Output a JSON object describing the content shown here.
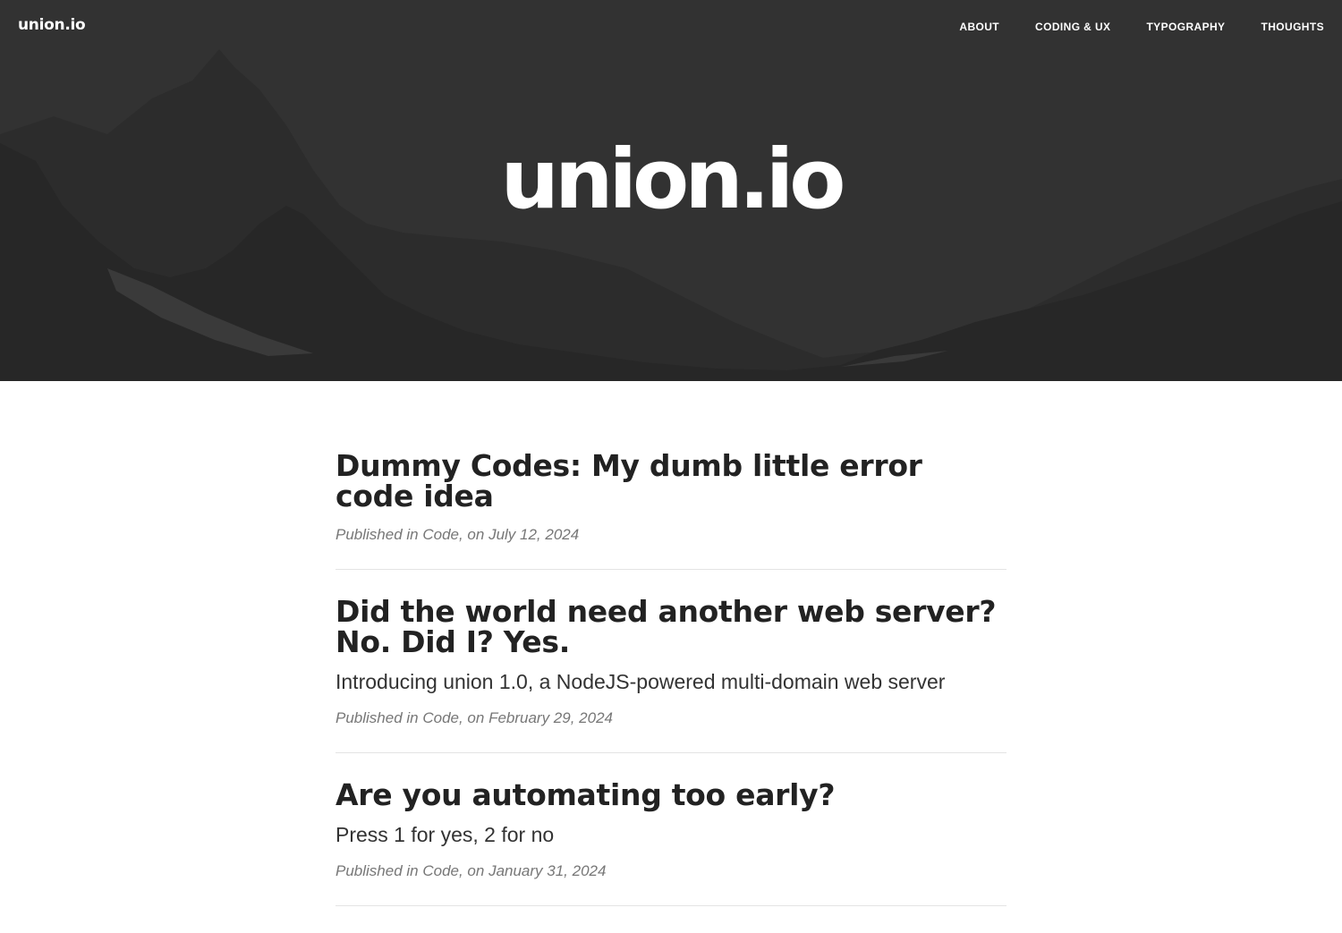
{
  "navbar": {
    "brand": "union.io",
    "links": [
      "ABOUT",
      "CODING & UX",
      "TYPOGRAPHY",
      "THOUGHTS"
    ]
  },
  "hero": {
    "title": "union.io"
  },
  "posts": [
    {
      "title": "Dummy Codes: My dumb little error code idea",
      "subtitle": "",
      "meta": "Published in Code, on July 12, 2024"
    },
    {
      "title": "Did the world need another web server? No. Did I? Yes.",
      "subtitle": "Introducing union 1.0, a NodeJS-powered multi-domain web server",
      "meta": "Published in Code, on February 29, 2024"
    },
    {
      "title": "Are you automating too early?",
      "subtitle": "Press 1 for yes, 2 for no",
      "meta": "Published in Code, on January 31, 2024"
    }
  ],
  "colors": {
    "hero_background": "#323232",
    "mountain_far": "#2b2b2b",
    "mountain_near": "#262626",
    "heading_text": "#222222",
    "meta_text": "#777777",
    "divider": "#e4e4e4"
  }
}
